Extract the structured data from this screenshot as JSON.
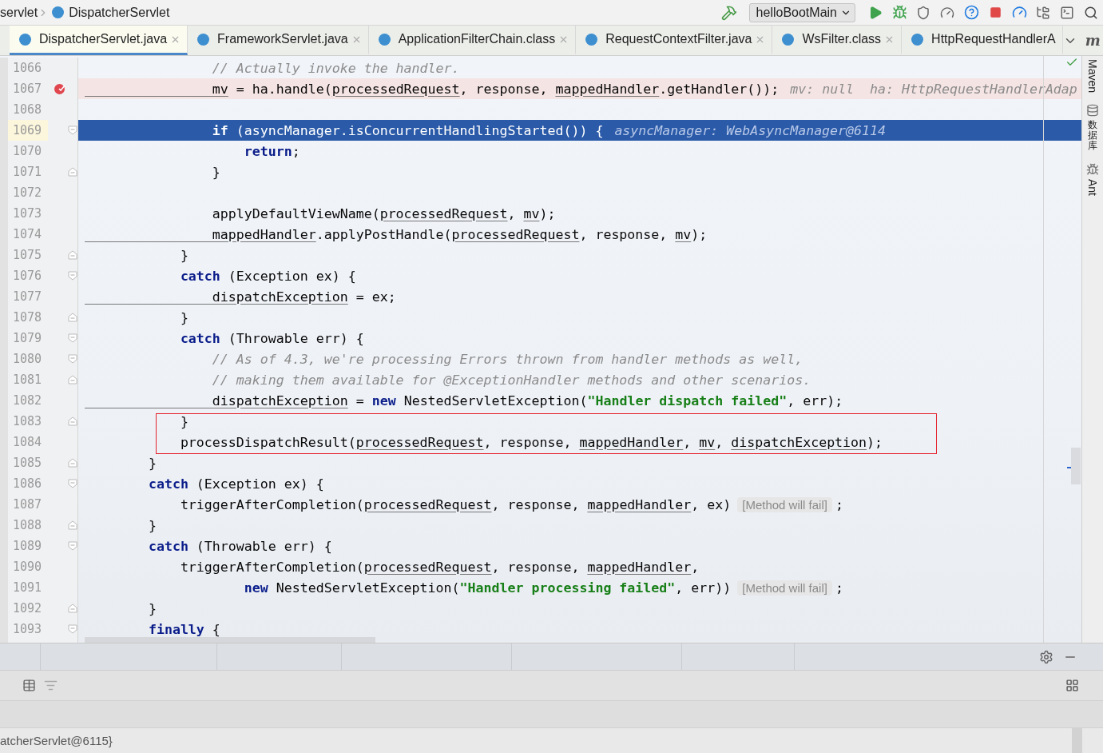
{
  "breadcrumb": {
    "items": [
      "servlet",
      "DispatcherServlet"
    ]
  },
  "run_config": "helloBootMain",
  "corner_icon": "m",
  "tabs": [
    {
      "label": "DispatcherServlet.java",
      "selected": true,
      "closable": true
    },
    {
      "label": "FrameworkServlet.java",
      "selected": false,
      "closable": true
    },
    {
      "label": "ApplicationFilterChain.class",
      "selected": false,
      "closable": true
    },
    {
      "label": "RequestContextFilter.java",
      "selected": false,
      "closable": true
    },
    {
      "label": "WsFilter.class",
      "selected": false,
      "closable": true
    },
    {
      "label": "HttpRequestHandlerA",
      "selected": false,
      "closable": false
    }
  ],
  "side_tools": [
    {
      "label": "Maven",
      "kind": "maven"
    },
    {
      "label": "数据库",
      "kind": "database"
    },
    {
      "label": "Ant",
      "kind": "ant"
    }
  ],
  "lines": [
    {
      "no": "1066",
      "fold_start": false,
      "fold_end": false,
      "breakpoint": false,
      "current": false,
      "boxed": false,
      "code": [
        {
          "kind": "comment",
          "text": "                // Actually invoke the handler."
        }
      ]
    },
    {
      "no": "1067",
      "fold_start": false,
      "fold_end": false,
      "breakpoint": true,
      "current": false,
      "boxed": false,
      "code": [
        {
          "kind": "field",
          "text": "                mv"
        },
        {
          "kind": "plain",
          "text": " = ha.handle("
        },
        {
          "kind": "field",
          "text": "processedRequest"
        },
        {
          "kind": "plain",
          "text": ", response, "
        },
        {
          "kind": "field",
          "text": "mappedHandler"
        },
        {
          "kind": "plain",
          "text": ".getHandler());"
        }
      ],
      "hint": {
        "kind": "value",
        "text": "mv: null  ha: HttpRequestHandlerAdap"
      }
    },
    {
      "no": "1068",
      "fold_start": false,
      "fold_end": false,
      "breakpoint": false,
      "current": false,
      "boxed": false
    },
    {
      "no": "1069",
      "fold_start": true,
      "fold_end": false,
      "breakpoint": false,
      "current": true,
      "boxed": false,
      "code": [
        {
          "kind": "keyword",
          "text": "                if"
        },
        {
          "kind": "plain",
          "text": " (asyncManager.isConcurrentHandlingStarted()) {"
        }
      ],
      "hint": {
        "kind": "value",
        "text": "asyncManager: WebAsyncManager@6114"
      }
    },
    {
      "no": "1070",
      "fold_start": false,
      "fold_end": false,
      "breakpoint": false,
      "current": false,
      "boxed": false,
      "code": [
        {
          "kind": "keyword",
          "text": "                    return"
        },
        {
          "kind": "plain",
          "text": ";"
        }
      ]
    },
    {
      "no": "1071",
      "fold_start": false,
      "fold_end": true,
      "breakpoint": false,
      "current": false,
      "boxed": false,
      "code": [
        {
          "kind": "plain",
          "text": "                }"
        }
      ]
    },
    {
      "no": "1072",
      "fold_start": false,
      "fold_end": false,
      "breakpoint": false,
      "current": false,
      "boxed": false
    },
    {
      "no": "1073",
      "fold_start": false,
      "fold_end": false,
      "breakpoint": false,
      "current": false,
      "boxed": false,
      "code": [
        {
          "kind": "plain",
          "text": "                applyDefaultViewName("
        },
        {
          "kind": "field",
          "text": "processedRequest"
        },
        {
          "kind": "plain",
          "text": ", "
        },
        {
          "kind": "field",
          "text": "mv"
        },
        {
          "kind": "plain",
          "text": ");"
        }
      ]
    },
    {
      "no": "1074",
      "fold_start": false,
      "fold_end": false,
      "breakpoint": false,
      "current": false,
      "boxed": false,
      "code": [
        {
          "kind": "field",
          "text": "                mappedHandler"
        },
        {
          "kind": "plain",
          "text": ".applyPostHandle("
        },
        {
          "kind": "field",
          "text": "processedRequest"
        },
        {
          "kind": "plain",
          "text": ", response, "
        },
        {
          "kind": "field",
          "text": "mv"
        },
        {
          "kind": "plain",
          "text": ");"
        }
      ]
    },
    {
      "no": "1075",
      "fold_start": false,
      "fold_end": true,
      "breakpoint": false,
      "current": false,
      "boxed": false,
      "code": [
        {
          "kind": "plain",
          "text": "            }"
        }
      ]
    },
    {
      "no": "1076",
      "fold_start": true,
      "fold_end": false,
      "breakpoint": false,
      "current": false,
      "boxed": false,
      "code": [
        {
          "kind": "keyword",
          "text": "            catch"
        },
        {
          "kind": "plain",
          "text": " (Exception ex) {"
        }
      ]
    },
    {
      "no": "1077",
      "fold_start": false,
      "fold_end": false,
      "breakpoint": false,
      "current": false,
      "boxed": false,
      "code": [
        {
          "kind": "field",
          "text": "                dispatchException"
        },
        {
          "kind": "plain",
          "text": " = ex;"
        }
      ]
    },
    {
      "no": "1078",
      "fold_start": false,
      "fold_end": true,
      "breakpoint": false,
      "current": false,
      "boxed": false,
      "code": [
        {
          "kind": "plain",
          "text": "            }"
        }
      ]
    },
    {
      "no": "1079",
      "fold_start": true,
      "fold_end": false,
      "breakpoint": false,
      "current": false,
      "boxed": false,
      "code": [
        {
          "kind": "keyword",
          "text": "            catch"
        },
        {
          "kind": "plain",
          "text": " (Throwable err) {"
        }
      ]
    },
    {
      "no": "1080",
      "fold_start": true,
      "fold_end": false,
      "breakpoint": false,
      "current": false,
      "boxed": false,
      "code": [
        {
          "kind": "comment",
          "text": "                // As of 4.3, we're processing Errors thrown from handler methods as well,"
        }
      ]
    },
    {
      "no": "1081",
      "fold_start": false,
      "fold_end": true,
      "breakpoint": false,
      "current": false,
      "boxed": false,
      "code": [
        {
          "kind": "comment",
          "text": "                // making them available for @ExceptionHandler methods and other scenarios."
        }
      ]
    },
    {
      "no": "1082",
      "fold_start": false,
      "fold_end": false,
      "breakpoint": false,
      "current": false,
      "boxed": false,
      "code": [
        {
          "kind": "field",
          "text": "                dispatchException"
        },
        {
          "kind": "plain",
          "text": " = "
        },
        {
          "kind": "keyword",
          "text": "new"
        },
        {
          "kind": "plain",
          "text": " NestedServletException("
        },
        {
          "kind": "string",
          "text": "\"Handler dispatch failed\""
        },
        {
          "kind": "plain",
          "text": ", err);"
        }
      ]
    },
    {
      "no": "1083",
      "fold_start": false,
      "fold_end": true,
      "breakpoint": false,
      "current": false,
      "boxed": true,
      "code": [
        {
          "kind": "plain",
          "text": "            }"
        }
      ]
    },
    {
      "no": "1084",
      "fold_start": false,
      "fold_end": false,
      "breakpoint": false,
      "current": false,
      "boxed": true,
      "code": [
        {
          "kind": "plain",
          "text": "            processDispatchResult("
        },
        {
          "kind": "field",
          "text": "processedRequest"
        },
        {
          "kind": "plain",
          "text": ", response, "
        },
        {
          "kind": "field",
          "text": "mappedHandler"
        },
        {
          "kind": "plain",
          "text": ", "
        },
        {
          "kind": "field",
          "text": "mv"
        },
        {
          "kind": "plain",
          "text": ", "
        },
        {
          "kind": "field",
          "text": "dispatchException"
        },
        {
          "kind": "plain",
          "text": ");"
        }
      ]
    },
    {
      "no": "1085",
      "fold_start": false,
      "fold_end": true,
      "breakpoint": false,
      "current": false,
      "boxed": false,
      "code": [
        {
          "kind": "plain",
          "text": "        }"
        }
      ]
    },
    {
      "no": "1086",
      "fold_start": true,
      "fold_end": false,
      "breakpoint": false,
      "current": false,
      "boxed": false,
      "code": [
        {
          "kind": "keyword",
          "text": "        catch"
        },
        {
          "kind": "plain",
          "text": " (Exception ex) {"
        }
      ]
    },
    {
      "no": "1087",
      "fold_start": false,
      "fold_end": false,
      "breakpoint": false,
      "current": false,
      "boxed": false,
      "code": [
        {
          "kind": "plain",
          "text": "            triggerAfterCompletion("
        },
        {
          "kind": "field",
          "text": "processedRequest"
        },
        {
          "kind": "plain",
          "text": ", response, "
        },
        {
          "kind": "field",
          "text": "mappedHandler"
        },
        {
          "kind": "plain",
          "text": ", ex)"
        }
      ],
      "hint": {
        "kind": "inspection",
        "text": "[Method will fail]"
      },
      "tail": ";"
    },
    {
      "no": "1088",
      "fold_start": false,
      "fold_end": true,
      "breakpoint": false,
      "current": false,
      "boxed": false,
      "code": [
        {
          "kind": "plain",
          "text": "        }"
        }
      ]
    },
    {
      "no": "1089",
      "fold_start": true,
      "fold_end": false,
      "breakpoint": false,
      "current": false,
      "boxed": false,
      "code": [
        {
          "kind": "keyword",
          "text": "        catch"
        },
        {
          "kind": "plain",
          "text": " (Throwable err) {"
        }
      ]
    },
    {
      "no": "1090",
      "fold_start": false,
      "fold_end": false,
      "breakpoint": false,
      "current": false,
      "boxed": false,
      "code": [
        {
          "kind": "plain",
          "text": "            triggerAfterCompletion("
        },
        {
          "kind": "field",
          "text": "processedRequest"
        },
        {
          "kind": "plain",
          "text": ", response, "
        },
        {
          "kind": "field",
          "text": "mappedHandler"
        },
        {
          "kind": "plain",
          "text": ","
        }
      ]
    },
    {
      "no": "1091",
      "fold_start": false,
      "fold_end": false,
      "breakpoint": false,
      "current": false,
      "boxed": false,
      "code": [
        {
          "kind": "keyword",
          "text": "                    new"
        },
        {
          "kind": "plain",
          "text": " NestedServletException("
        },
        {
          "kind": "string",
          "text": "\"Handler processing failed\""
        },
        {
          "kind": "plain",
          "text": ", err))"
        }
      ],
      "hint": {
        "kind": "inspection",
        "text": "[Method will fail]"
      },
      "tail": ";"
    },
    {
      "no": "1092",
      "fold_start": false,
      "fold_end": true,
      "breakpoint": false,
      "current": false,
      "boxed": false,
      "code": [
        {
          "kind": "plain",
          "text": "        }"
        }
      ]
    },
    {
      "no": "1093",
      "fold_start": true,
      "fold_end": false,
      "breakpoint": false,
      "current": false,
      "boxed": false,
      "code": [
        {
          "kind": "keyword",
          "text": "        finally"
        },
        {
          "kind": "plain",
          "text": " {"
        }
      ]
    }
  ],
  "variables": {
    "row_text": "atcherServlet@6115}"
  }
}
